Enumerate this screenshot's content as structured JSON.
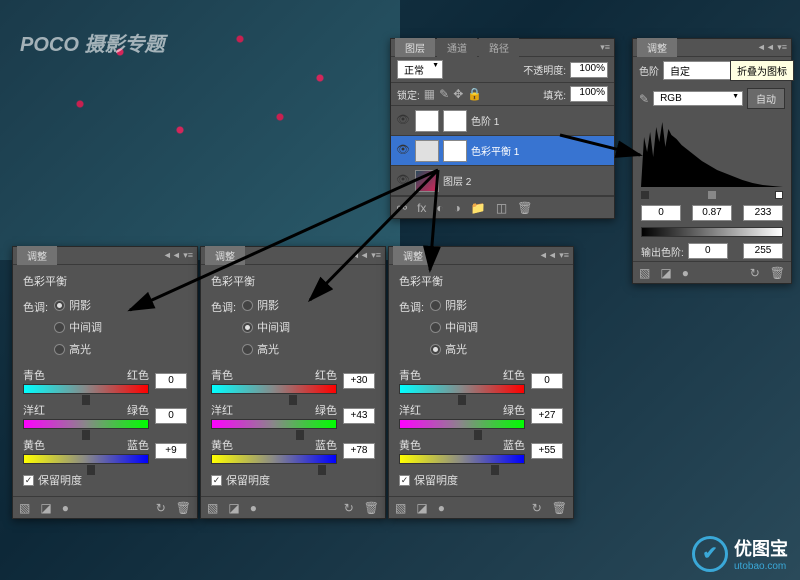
{
  "watermark": "POCO 摄影专题",
  "tooltip": "折叠为图标",
  "panels": {
    "adjust_tab": "调整",
    "color_balance_title": "色彩平衡",
    "tone_label": "色调:",
    "tone_shadows": "阴影",
    "tone_midtones": "中间调",
    "tone_highlights": "高光",
    "slider_cyan": "青色",
    "slider_red": "红色",
    "slider_magenta": "洋红",
    "slider_green": "绿色",
    "slider_yellow": "黄色",
    "slider_blue": "蓝色",
    "preserve_lum": "保留明度"
  },
  "cb_shadows": {
    "cr": "0",
    "mg": "0",
    "yb": "+9"
  },
  "cb_midtones": {
    "cr": "+30",
    "mg": "+43",
    "yb": "+78"
  },
  "cb_highlights": {
    "cr": "0",
    "mg": "+27",
    "yb": "+55"
  },
  "layers": {
    "tab_layers": "图层",
    "tab_channels": "通道",
    "tab_paths": "路径",
    "blend_mode": "正常",
    "opacity_label": "不透明度:",
    "opacity_val": "100%",
    "lock_label": "锁定:",
    "fill_label": "填充:",
    "fill_val": "100%",
    "layer1": "色阶 1",
    "layer2": "色彩平衡 1",
    "layer3": "图层 2"
  },
  "levels": {
    "tab": "调整",
    "title_label": "色阶",
    "preset": "自定",
    "channel": "RGB",
    "auto": "自动",
    "in_black": "0",
    "in_mid": "0.87",
    "in_white": "233",
    "out_label": "输出色阶:",
    "out_black": "0",
    "out_white": "255"
  },
  "logo": {
    "text": "优图宝",
    "url": "utobao.com"
  }
}
